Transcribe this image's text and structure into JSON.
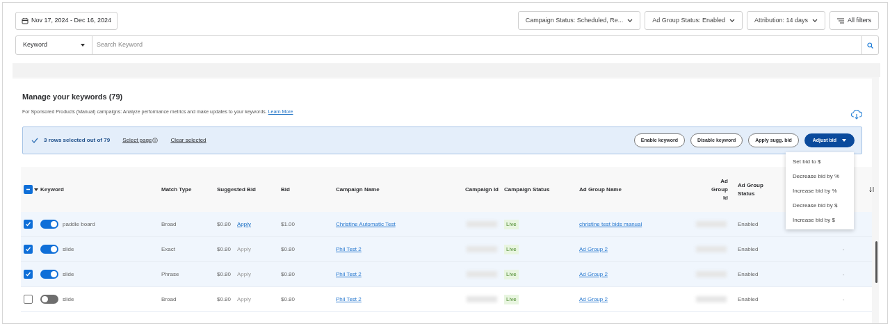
{
  "date_range": "Nov 17, 2024 - Dec 16, 2024",
  "filters": [
    "Campaign Status: Scheduled, Re...",
    "Ad Group Status: Enabled",
    "Attribution: 14 days"
  ],
  "all_filters": "All filters",
  "search": {
    "category": "Keyword",
    "placeholder": "Search Keyword"
  },
  "section": {
    "title": "Manage your keywords (79)",
    "description": "For Sponsored Products (Manual) campaigns: Analyze performance metrics and make updates to your keywords.",
    "learn_more": "Learn More"
  },
  "selection": {
    "summary": "3 rows selected out of 79",
    "select_page": "Select page",
    "clear_selected": "Clear selected"
  },
  "actions": [
    "Enable keyword",
    "Disable keyword",
    "Apply sugg. bid"
  ],
  "adjust_bid": {
    "label": "Adjust bid",
    "expanded": true,
    "menu": [
      "Set bid to $",
      "Decrease bid by %",
      "Increase bid by %",
      "Decrease bid by $",
      "Increase bid by $"
    ]
  },
  "table": {
    "header_checkbox": {
      "checked": true,
      "indeterminate": true
    },
    "columns": [
      "Keyword",
      "Match Type",
      "Suggested Bid",
      "Bid",
      "Campaign Name",
      "Campaign Id",
      "Campaign Status",
      "Ad Group Name",
      "Ad Group Id",
      "Ad Group Status"
    ],
    "rows": [
      {
        "selected": true,
        "enabled": true,
        "keyword": "paddle board",
        "match_type": "Broad",
        "suggested_bid": "$0.80",
        "apply": {
          "label": "Apply",
          "disabled": false
        },
        "bid": "$1.00",
        "campaign_name": "Christine Automatic Test",
        "campaign_status": "Live",
        "ad_group_name": "christine test bids manual",
        "ad_group_status": "Enabled",
        "ids_redacted": true
      },
      {
        "selected": true,
        "enabled": true,
        "keyword": "slide",
        "match_type": "Exact",
        "suggested_bid": "$0.80",
        "apply": {
          "label": "Apply",
          "disabled": true
        },
        "bid": "$0.80",
        "campaign_name": "Phil Test 2",
        "campaign_status": "Live",
        "ad_group_name": "Ad Group 2",
        "ad_group_status": "Enabled",
        "ids_redacted": true,
        "column_12": "-"
      },
      {
        "selected": true,
        "enabled": true,
        "keyword": "slide",
        "match_type": "Phrase",
        "suggested_bid": "$0.80",
        "apply": {
          "label": "Apply",
          "disabled": true
        },
        "bid": "$0.80",
        "campaign_name": "Phil Test 2",
        "campaign_status": "Live",
        "ad_group_name": "Ad Group 2",
        "ad_group_status": "Enabled",
        "ids_redacted": true,
        "column_12": "-"
      },
      {
        "selected": false,
        "enabled": false,
        "keyword": "slide",
        "match_type": "Broad",
        "suggested_bid": "$0.80",
        "apply": {
          "label": "Apply",
          "disabled": true
        },
        "bid": "$0.80",
        "campaign_name": "Phil Test 2",
        "campaign_status": "Live",
        "ad_group_name": "Ad Group 2",
        "ad_group_status": "Enabled",
        "ids_redacted": true,
        "column_12": "-"
      }
    ]
  }
}
